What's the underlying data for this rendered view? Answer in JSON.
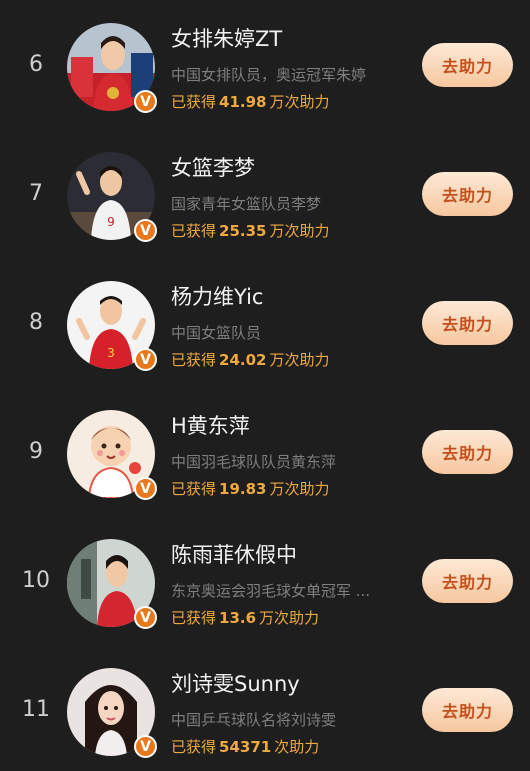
{
  "list": {
    "items": [
      {
        "rank": "6",
        "name": "女排朱婷ZT",
        "desc": "中国女排队员，奥运冠军朱婷",
        "prefix": "已获得",
        "number": "41.98",
        "suffix": "万次助力",
        "button": "去助力",
        "verify": "V"
      },
      {
        "rank": "7",
        "name": "女篮李梦",
        "desc": "国家青年女篮队员李梦",
        "prefix": "已获得",
        "number": "25.35",
        "suffix": "万次助力",
        "button": "去助力",
        "verify": "V"
      },
      {
        "rank": "8",
        "name": "杨力维Yic",
        "desc": "中国女篮队员",
        "prefix": "已获得",
        "number": "24.02",
        "suffix": "万次助力",
        "button": "去助力",
        "verify": "V"
      },
      {
        "rank": "9",
        "name": "H黄东萍",
        "desc": "中国羽毛球队队员黄东萍",
        "prefix": "已获得",
        "number": "19.83",
        "suffix": "万次助力",
        "button": "去助力",
        "verify": "V"
      },
      {
        "rank": "10",
        "name": "陈雨菲休假中",
        "desc": "东京奥运会羽毛球女单冠军 ...",
        "prefix": "已获得",
        "number": "13.6",
        "suffix": "万次助力",
        "button": "去助力",
        "verify": "V"
      },
      {
        "rank": "11",
        "name": "刘诗雯Sunny",
        "desc": "中国乒乓球队名将刘诗雯",
        "prefix": "已获得",
        "number": "54371",
        "suffix": "次助力",
        "button": "去助力",
        "verify": "V"
      }
    ]
  }
}
